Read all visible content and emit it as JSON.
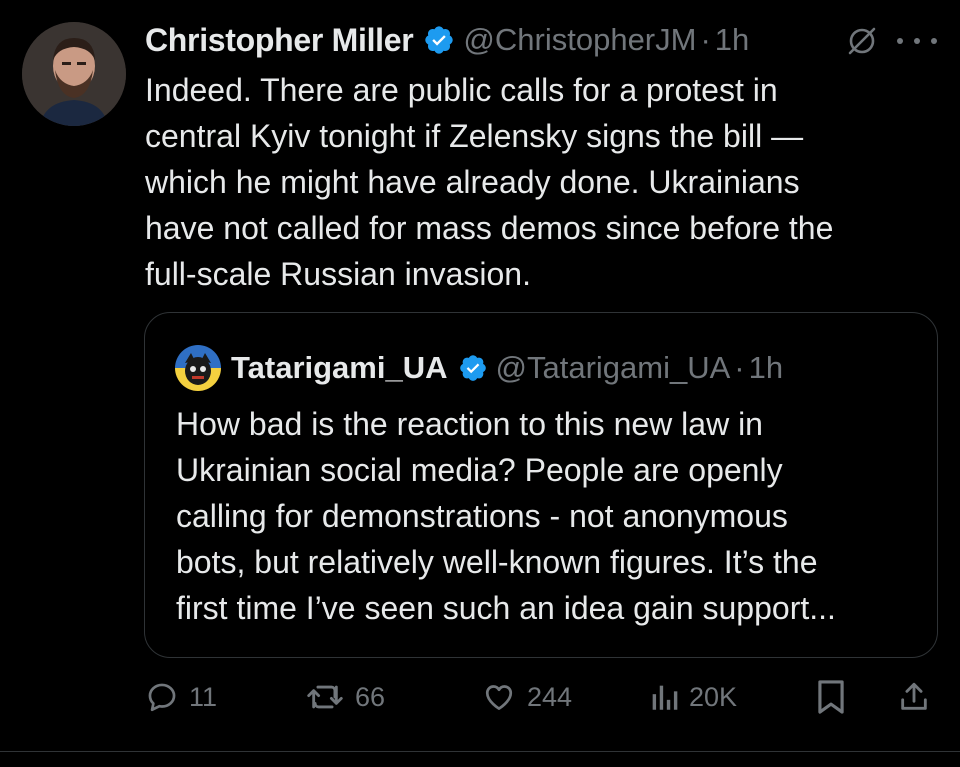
{
  "tweet": {
    "author_name": "Christopher Miller",
    "handle": "@ChristopherJM",
    "separator": "·",
    "time": "1h",
    "text_lines": [
      "Indeed. There are public calls for a protest in",
      "central Kyiv tonight if Zelensky signs the bill —",
      "which he might have already done. Ukrainians",
      "have not called for mass demos since before the",
      "full-scale Russian invasion."
    ]
  },
  "quote": {
    "author_name": "Tatarigami_UA",
    "handle": "@Tatarigami_UA",
    "separator": "·",
    "time": "1h",
    "text_lines": [
      "How bad is the reaction to this new law in",
      "Ukrainian social media? People are openly",
      "calling for demonstrations - not anonymous",
      "bots, but relatively well-known figures. It’s the",
      "first time I’ve seen such an idea gain support..."
    ]
  },
  "actions": {
    "replies": "11",
    "reposts": "66",
    "likes": "244",
    "views": "20K"
  },
  "colors": {
    "background": "#000000",
    "text": "#e7e9ea",
    "muted": "#71767b",
    "verified": "#1d9bf0",
    "border": "#2f3336"
  },
  "icons": [
    "verified-badge-icon",
    "grok-icon",
    "more-icon",
    "reply-icon",
    "repost-icon",
    "like-icon",
    "views-icon",
    "bookmark-icon",
    "share-icon"
  ]
}
